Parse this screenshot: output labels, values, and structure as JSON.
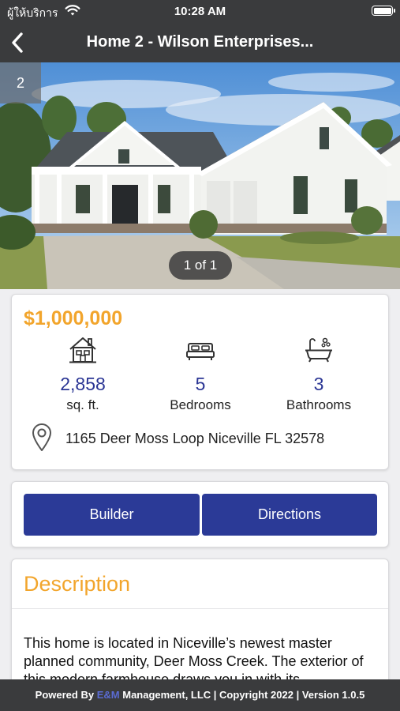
{
  "status_bar": {
    "carrier": "ผู้ให้บริการ",
    "time": "10:28 AM"
  },
  "nav": {
    "title": "Home 2 - Wilson Enterprises..."
  },
  "gallery": {
    "photo_count": "2",
    "pager": "1 of 1"
  },
  "listing": {
    "price": "$1,000,000",
    "stats": [
      {
        "icon": "house-icon",
        "value": "2,858",
        "label": "sq. ft."
      },
      {
        "icon": "bed-icon",
        "value": "5",
        "label": "Bedrooms"
      },
      {
        "icon": "bathtub-icon",
        "value": "3",
        "label": "Bathrooms"
      }
    ],
    "address": "1165 Deer Moss Loop Niceville FL 32578"
  },
  "actions": {
    "builder_label": "Builder",
    "directions_label": "Directions"
  },
  "description": {
    "title": "Description",
    "body": "This home is located in Niceville’s newest master planned community, Deer Moss Creek. The exterior of this modern farmhouse draws you in with its"
  },
  "footer": {
    "prefix": "Powered By",
    "brand": "E&M",
    "suffix": "Management, LLC | Copyright 2022 | Version 1.0.5"
  },
  "colors": {
    "bar_background": "#3a3b3d",
    "accent_orange": "#f2a52c",
    "stat_blue": "#2a3594",
    "button_blue": "#2b3a97"
  }
}
